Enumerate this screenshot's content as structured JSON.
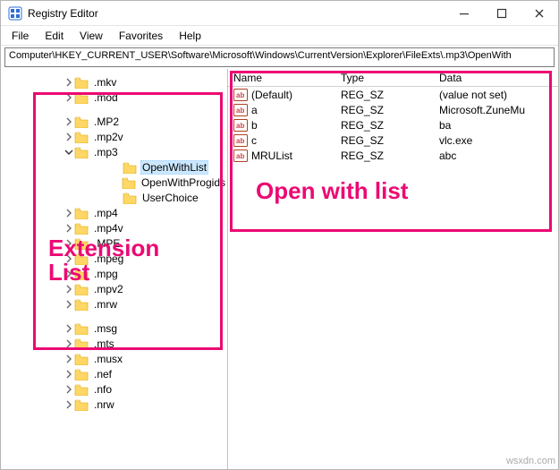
{
  "window": {
    "title": "Registry Editor"
  },
  "menu": {
    "items": [
      "File",
      "Edit",
      "View",
      "Favorites",
      "Help"
    ]
  },
  "address": {
    "path": "Computer\\HKEY_CURRENT_USER\\Software\\Microsoft\\Windows\\CurrentVersion\\Explorer\\FileExts\\.mp3\\OpenWith"
  },
  "tree": {
    "top": [
      {
        "label": ".mkv",
        "expandable": true
      },
      {
        "label": ".mod",
        "expandable": true
      }
    ],
    "mid": [
      {
        "label": ".MP2",
        "expandable": true
      },
      {
        "label": ".mp2v",
        "expandable": true
      },
      {
        "label": ".mp3",
        "expandable": true,
        "expanded": true,
        "children": [
          {
            "label": "OpenWithList",
            "selected": true
          },
          {
            "label": "OpenWithProgids"
          },
          {
            "label": "UserChoice"
          }
        ]
      },
      {
        "label": ".mp4",
        "expandable": true
      },
      {
        "label": ".mp4v",
        "expandable": true
      },
      {
        "label": ".MPE",
        "expandable": true
      },
      {
        "label": ".mpeg",
        "expandable": true
      },
      {
        "label": ".mpg",
        "expandable": true
      },
      {
        "label": ".mpv2",
        "expandable": true
      },
      {
        "label": ".mrw",
        "expandable": true
      }
    ],
    "bottom": [
      {
        "label": ".msg",
        "expandable": true
      },
      {
        "label": ".mts",
        "expandable": true
      },
      {
        "label": ".musx",
        "expandable": true
      },
      {
        "label": ".nef",
        "expandable": true
      },
      {
        "label": ".nfo",
        "expandable": true
      },
      {
        "label": ".nrw",
        "expandable": true
      }
    ]
  },
  "columns": {
    "name": "Name",
    "type": "Type",
    "data": "Data"
  },
  "values": [
    {
      "name": "(Default)",
      "type": "REG_SZ",
      "data": "(value not set)"
    },
    {
      "name": "a",
      "type": "REG_SZ",
      "data": "Microsoft.ZuneMu"
    },
    {
      "name": "b",
      "type": "REG_SZ",
      "data": "ba"
    },
    {
      "name": "c",
      "type": "REG_SZ",
      "data": "vlc.exe"
    },
    {
      "name": "MRUList",
      "type": "REG_SZ",
      "data": "abc"
    }
  ],
  "annotations": {
    "left_label_1": "Extension",
    "left_label_2": "List",
    "right_label": "Open with list"
  },
  "watermark": "wsxdn.com"
}
